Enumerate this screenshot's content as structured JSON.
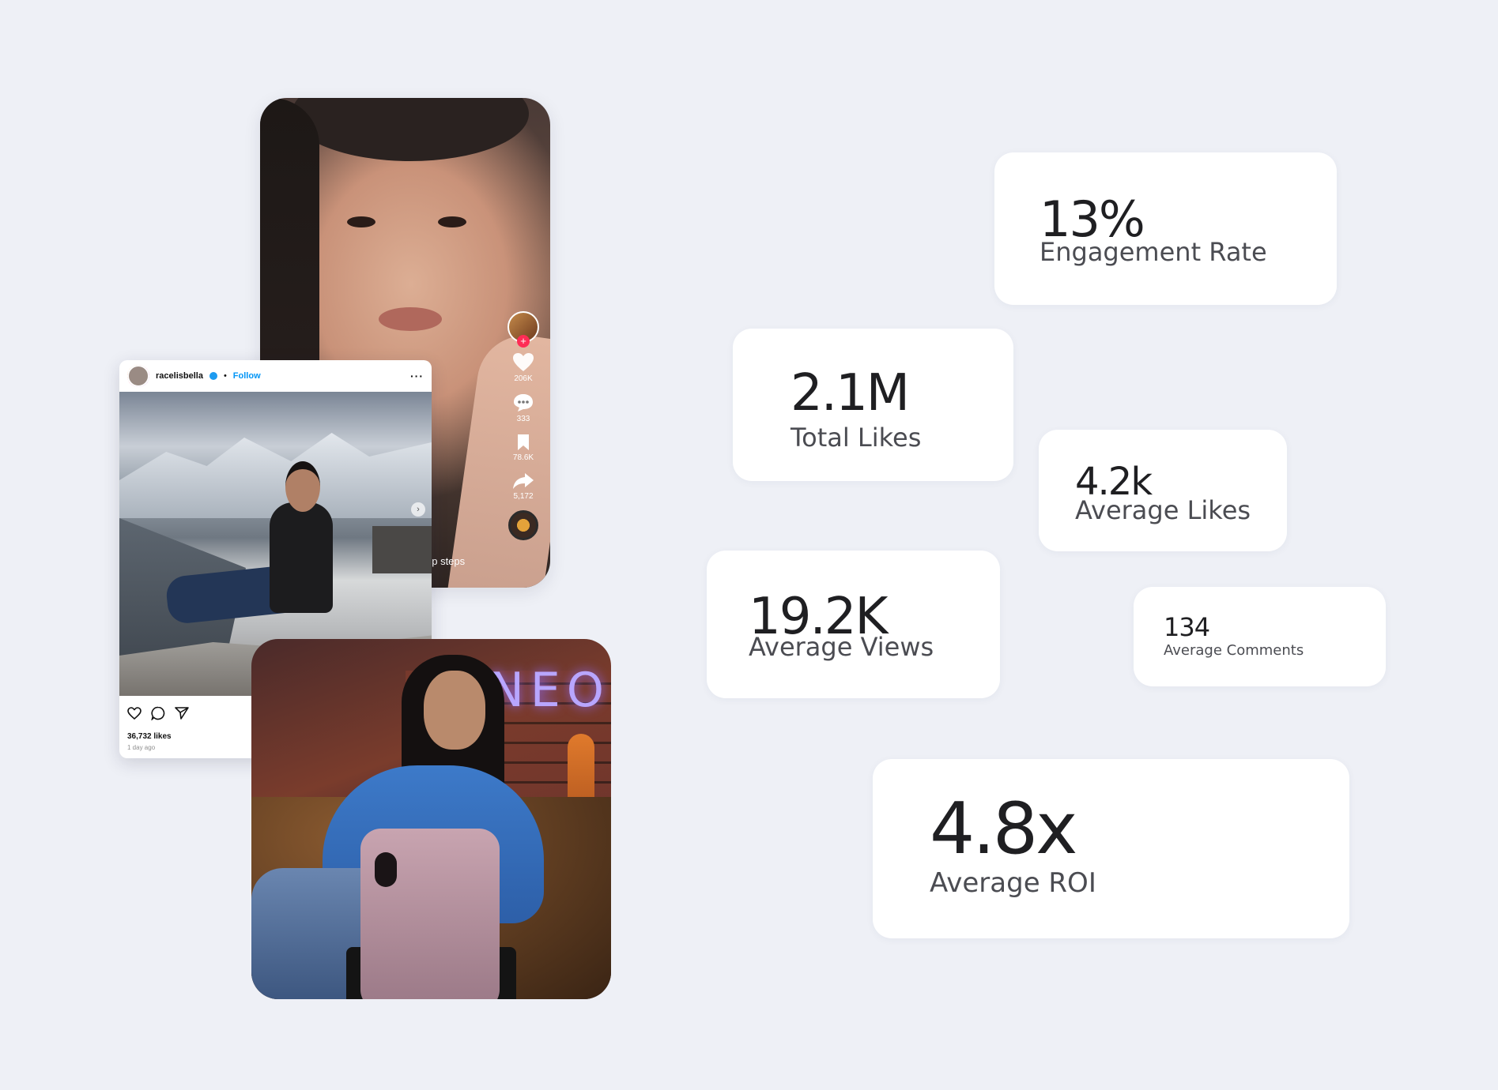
{
  "tiktok": {
    "likes": "206K",
    "comments": "333",
    "saves": "78.6K",
    "shares": "5,172",
    "caption": "up steps"
  },
  "instagram": {
    "username": "racelisbella",
    "separator": "•",
    "follow": "Follow",
    "more": "···",
    "likes": "36,732 likes",
    "time": "1 day ago"
  },
  "vlog": {
    "neon_text": "NEO"
  },
  "stats": {
    "engagement": {
      "value": "13%",
      "label": "Engagement Rate"
    },
    "total_likes": {
      "value": "2.1M",
      "label": "Total Likes"
    },
    "average_likes": {
      "value": "4.2k",
      "label": "Average Likes"
    },
    "average_views": {
      "value": "19.2K",
      "label": "Average Views"
    },
    "average_comments": {
      "value": "134",
      "label": "Average Comments"
    },
    "roi": {
      "value": "4.8x",
      "label": "Average ROI"
    }
  },
  "colors": {
    "background": "#eef0f6",
    "card": "#ffffff",
    "tiktok_red": "#fe2c55",
    "instagram_blue": "#0095f6"
  }
}
